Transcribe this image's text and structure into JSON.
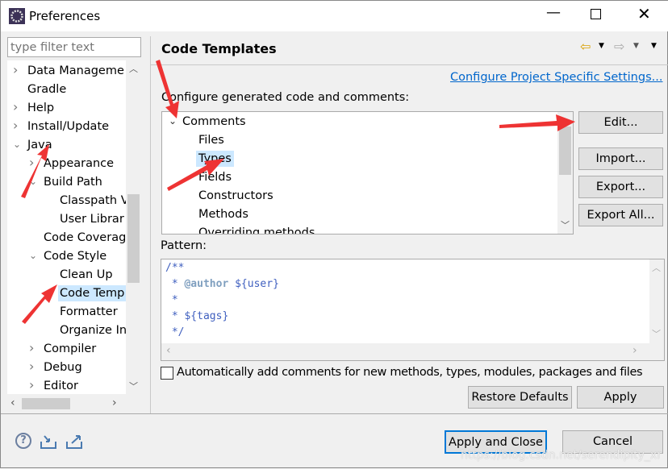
{
  "window": {
    "title": "Preferences",
    "controls": [
      "minimize",
      "maximize",
      "close"
    ]
  },
  "sidebar": {
    "filter_placeholder": "type filter text",
    "items": [
      {
        "label": "Data Manageme",
        "indent": 0,
        "state": "collapsed"
      },
      {
        "label": "Gradle",
        "indent": 0,
        "state": "leaf"
      },
      {
        "label": "Help",
        "indent": 0,
        "state": "collapsed"
      },
      {
        "label": "Install/Update",
        "indent": 0,
        "state": "collapsed"
      },
      {
        "label": "Java",
        "indent": 0,
        "state": "expanded"
      },
      {
        "label": "Appearance",
        "indent": 1,
        "state": "collapsed"
      },
      {
        "label": "Build Path",
        "indent": 1,
        "state": "expanded"
      },
      {
        "label": "Classpath V",
        "indent": 2,
        "state": "leaf"
      },
      {
        "label": "User Librar",
        "indent": 2,
        "state": "leaf"
      },
      {
        "label": "Code Coverag",
        "indent": 1,
        "state": "leaf"
      },
      {
        "label": "Code Style",
        "indent": 1,
        "state": "expanded"
      },
      {
        "label": "Clean Up",
        "indent": 2,
        "state": "leaf"
      },
      {
        "label": "Code Temp",
        "indent": 2,
        "state": "leaf",
        "selected": true
      },
      {
        "label": "Formatter",
        "indent": 2,
        "state": "leaf"
      },
      {
        "label": "Organize In",
        "indent": 2,
        "state": "leaf"
      },
      {
        "label": "Compiler",
        "indent": 1,
        "state": "collapsed"
      },
      {
        "label": "Debug",
        "indent": 1,
        "state": "collapsed"
      },
      {
        "label": "Editor",
        "indent": 1,
        "state": "collapsed"
      }
    ]
  },
  "main": {
    "title": "Code Templates",
    "project_link": "Configure Project Specific Settings...",
    "description": "Configure generated code and comments:",
    "templates": [
      {
        "label": "Comments",
        "indent": 0,
        "state": "expanded"
      },
      {
        "label": "Files",
        "indent": 1
      },
      {
        "label": "Types",
        "indent": 1,
        "selected": true
      },
      {
        "label": "Fields",
        "indent": 1
      },
      {
        "label": "Constructors",
        "indent": 1
      },
      {
        "label": "Methods",
        "indent": 1
      },
      {
        "label": "Overriding methods",
        "indent": 1
      }
    ],
    "buttons": {
      "edit": "Edit...",
      "import": "Import...",
      "export": "Export...",
      "export_all": "Export All..."
    },
    "pattern_label": "Pattern:",
    "pattern_lines": [
      [
        {
          "t": "/**",
          "c": "#3f5fbf"
        }
      ],
      [
        {
          "t": " * ",
          "c": "#3f5fbf"
        },
        {
          "t": "@author",
          "c": "#7f9fbf",
          "b": true
        },
        {
          "t": " ${user}",
          "c": "#3f5fbf"
        }
      ],
      [
        {
          "t": " *",
          "c": "#3f5fbf"
        }
      ],
      [
        {
          "t": " * ${tags}",
          "c": "#3f5fbf"
        }
      ],
      [
        {
          "t": " */",
          "c": "#3f5fbf"
        }
      ]
    ],
    "auto_comments_label": "Automatically add comments for new methods, types, modules, packages and files",
    "auto_comments_checked": false,
    "restore_defaults": "Restore Defaults",
    "apply": "Apply"
  },
  "footer": {
    "apply_close": "Apply and Close",
    "cancel": "Cancel",
    "watermark": "https://blog.csdn.net/serendipity_xr"
  },
  "colors": {
    "selection": "#cce8ff",
    "link": "#0066cc",
    "focus": "#0078d7",
    "arrow": "#ee3333"
  }
}
